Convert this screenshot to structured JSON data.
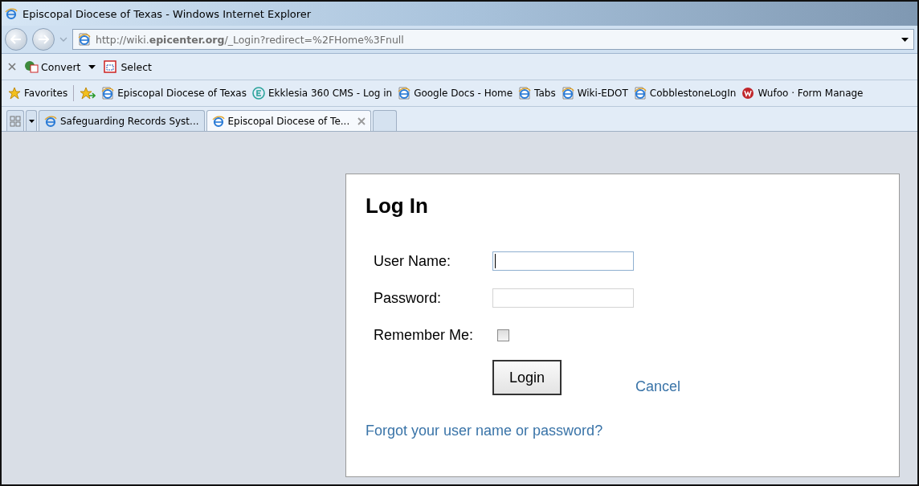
{
  "window": {
    "title": "Episcopal Diocese of Texas - Windows Internet Explorer"
  },
  "address_bar": {
    "url": "http://wiki.**epicenter.org**/_Login?redirect=%2FHome%3Fnull"
  },
  "command_bar": {
    "items": [
      {
        "label": "Convert",
        "kind": "convert"
      },
      {
        "label": "Select",
        "kind": "select"
      }
    ]
  },
  "favorites_bar": {
    "label": "Favorites",
    "items": [
      {
        "label": "Episcopal Diocese of Texas",
        "kind": "page"
      },
      {
        "label": "Ekklesia 360 CMS - Log in",
        "kind": "ekklesia"
      },
      {
        "label": "Google Docs - Home",
        "kind": "page"
      },
      {
        "label": "Tabs",
        "kind": "page"
      },
      {
        "label": "Wiki-EDOT",
        "kind": "page"
      },
      {
        "label": "CobblestoneLogIn",
        "kind": "page"
      },
      {
        "label": "Wufoo · Form Manage",
        "kind": "wufoo"
      }
    ]
  },
  "tabs": [
    {
      "label": "Safeguarding Records Syst...",
      "selected": false
    },
    {
      "label": "Episcopal Diocese of Te...",
      "selected": true
    }
  ],
  "login_form": {
    "title": "Log In",
    "fields": [
      {
        "label": "User Name:",
        "kind": "text",
        "focused": true
      },
      {
        "label": "Password:",
        "kind": "password",
        "focused": false
      },
      {
        "label": "Remember Me:",
        "kind": "checkbox",
        "checked": false
      }
    ],
    "submit": "Login",
    "cancel": "Cancel",
    "forgot_link": "Forgot your user name or password?"
  }
}
